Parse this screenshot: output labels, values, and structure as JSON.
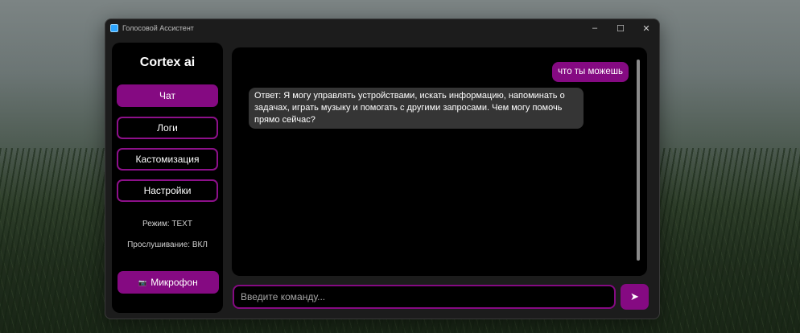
{
  "window": {
    "title": "Голосовой Ассистент",
    "controls": {
      "minimize": "–",
      "maximize": "☐",
      "close": "✕"
    }
  },
  "sidebar": {
    "brand": "Cortex ai",
    "nav": [
      {
        "label": "Чат",
        "active": true
      },
      {
        "label": "Логи",
        "active": false
      },
      {
        "label": "Кастомизация",
        "active": false
      },
      {
        "label": "Настройки",
        "active": false
      }
    ],
    "mode_status": "Режим: TEXT",
    "listening_status": "Прослушивание: ВКЛ",
    "mic_button": {
      "icon": "📷",
      "label": "Микрофон"
    }
  },
  "chat": {
    "messages": [
      {
        "role": "user",
        "text": "что ты можешь"
      },
      {
        "role": "assistant",
        "text": "Ответ: Я могу управлять устройствами, искать информацию, напоминать о задачах, играть музыку и помогать с другими запросами. Чем могу помочь прямо сейчас?"
      }
    ]
  },
  "input": {
    "placeholder": "Введите команду...",
    "value": ""
  },
  "send_button": {
    "icon": "➤"
  },
  "colors": {
    "accent": "#850a82",
    "panel": "#000000",
    "window_bg": "#1c1c1c",
    "bot_bubble": "#353535"
  }
}
